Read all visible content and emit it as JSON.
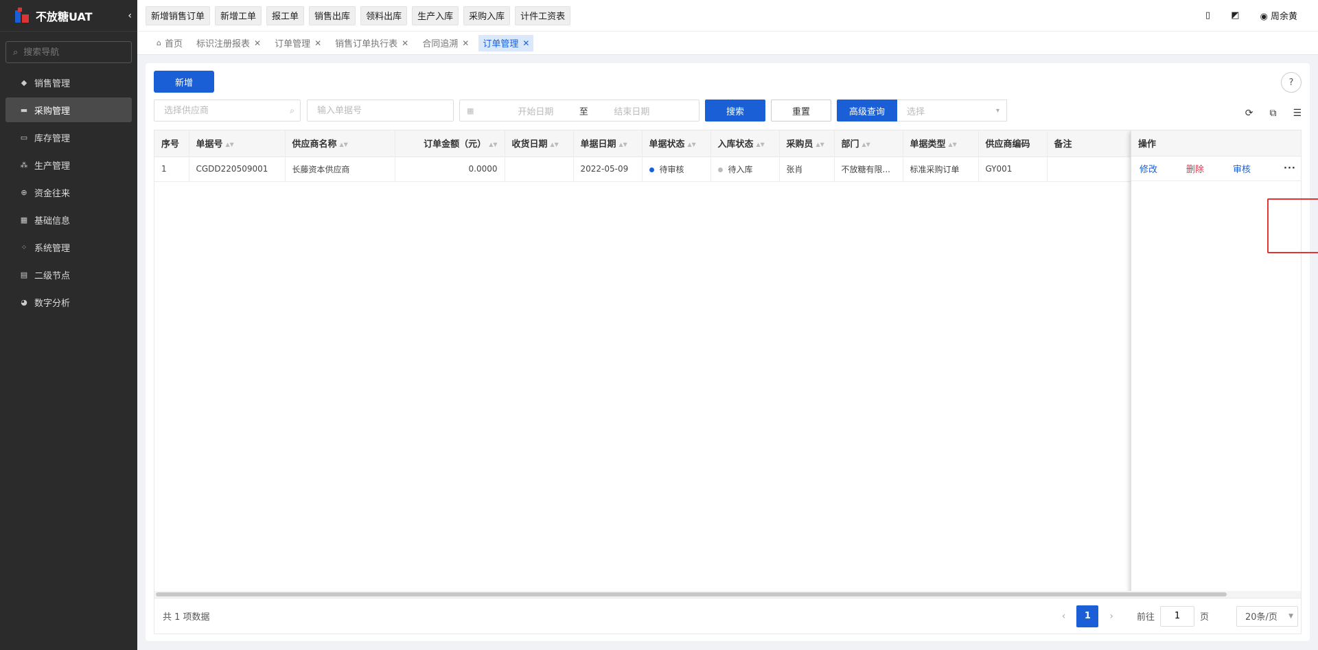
{
  "app": {
    "title": "不放糖UAT",
    "collapse_icon": "chevron-left-icon"
  },
  "sidebar": {
    "search_placeholder": "搜索导航",
    "items": [
      {
        "label": "销售管理",
        "icon": "tag-icon"
      },
      {
        "label": "采购管理",
        "icon": "cart-icon",
        "active": true
      },
      {
        "label": "库存管理",
        "icon": "box-icon"
      },
      {
        "label": "生产管理",
        "icon": "factory-icon"
      },
      {
        "label": "资金往来",
        "icon": "plus-circle-icon"
      },
      {
        "label": "基础信息",
        "icon": "grid-icon"
      },
      {
        "label": "系统管理",
        "icon": "apps-icon"
      },
      {
        "label": "二级节点",
        "icon": "document-icon"
      },
      {
        "label": "数字分析",
        "icon": "pie-chart-icon"
      }
    ]
  },
  "quick_actions": [
    "新增销售订单",
    "新增工单",
    "报工单",
    "销售出库",
    "领料出库",
    "生产入库",
    "采购入库",
    "计件工资表"
  ],
  "user": {
    "name": "周余黄"
  },
  "tabs": [
    {
      "label": "首页"
    },
    {
      "label": "标识注册报表"
    },
    {
      "label": "订单管理"
    },
    {
      "label": "销售订单执行表"
    },
    {
      "label": "合同追溯"
    },
    {
      "label": "订单管理",
      "active": true
    }
  ],
  "toolbar": {
    "add_label": "新增",
    "supplier_placeholder": "选择供应商",
    "docno_placeholder": "输入单据号",
    "start_date_placeholder": "开始日期",
    "date_sep": "至",
    "end_date_placeholder": "结束日期",
    "search_label": "搜索",
    "reset_label": "重置",
    "advanced_label": "高级查询",
    "advanced_select_placeholder": "选择"
  },
  "table": {
    "columns": [
      "序号",
      "单据号",
      "供应商名称",
      "订单金额（元）",
      "收货日期",
      "单据日期",
      "单据状态",
      "入库状态",
      "采购员",
      "部门",
      "单据类型",
      "供应商编码",
      "备注"
    ],
    "ops_header": "操作",
    "rows": [
      {
        "index": "1",
        "doc_no": "CGDD220509001",
        "supplier": "长藤资本供应商",
        "amount": "0.0000",
        "receive_date": "",
        "doc_date": "2022-05-09",
        "doc_status": "待审核",
        "doc_status_color": "#1a5fd6",
        "stock_status": "待入库",
        "stock_status_color": "#bbbbbb",
        "buyer": "张肖",
        "dept": "不放糖有限...",
        "doc_type": "标准采购订单",
        "supplier_code": "GY001",
        "remark": "",
        "ops": {
          "edit": "修改",
          "delete": "删除",
          "audit": "审核",
          "more": "···"
        }
      }
    ]
  },
  "footer": {
    "total_text": "共 1 项数据",
    "current_page": "1",
    "goto_label": "前往",
    "goto_value": "1",
    "page_unit": "页",
    "page_size": "20条/页"
  }
}
